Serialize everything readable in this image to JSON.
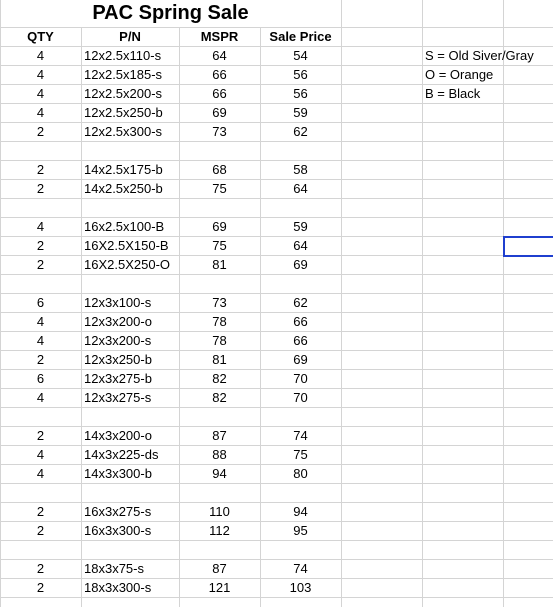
{
  "title": "PAC Spring Sale",
  "headers": {
    "qty": "QTY",
    "pn": "P/N",
    "mspr": "MSPR",
    "sale": "Sale Price"
  },
  "rows": [
    {
      "qty": "4",
      "pn": "12x2.5x110-s",
      "mspr": "64",
      "sale": "54"
    },
    {
      "qty": "4",
      "pn": "12x2.5x185-s",
      "mspr": "66",
      "sale": "56"
    },
    {
      "qty": "4",
      "pn": "12x2.5x200-s",
      "mspr": "66",
      "sale": "56"
    },
    {
      "qty": "4",
      "pn": "12x2.5x250-b",
      "mspr": "69",
      "sale": "59"
    },
    {
      "qty": "2",
      "pn": "12x2.5x300-s",
      "mspr": "73",
      "sale": "62"
    },
    null,
    {
      "qty": "2",
      "pn": "14x2.5x175-b",
      "mspr": "68",
      "sale": "58"
    },
    {
      "qty": "2",
      "pn": "14x2.5x250-b",
      "mspr": "75",
      "sale": "64"
    },
    null,
    {
      "qty": "4",
      "pn": "16x2.5x100-B",
      "mspr": "69",
      "sale": "59"
    },
    {
      "qty": "2",
      "pn": "16X2.5X150-B",
      "mspr": "75",
      "sale": "64"
    },
    {
      "qty": "2",
      "pn": "16X2.5X250-O",
      "mspr": "81",
      "sale": "69"
    },
    null,
    {
      "qty": "6",
      "pn": "12x3x100-s",
      "mspr": "73",
      "sale": "62"
    },
    {
      "qty": "4",
      "pn": "12x3x200-o",
      "mspr": "78",
      "sale": "66"
    },
    {
      "qty": "4",
      "pn": "12x3x200-s",
      "mspr": "78",
      "sale": "66"
    },
    {
      "qty": "2",
      "pn": "12x3x250-b",
      "mspr": "81",
      "sale": "69"
    },
    {
      "qty": "6",
      "pn": "12x3x275-b",
      "mspr": "82",
      "sale": "70"
    },
    {
      "qty": "4",
      "pn": "12x3x275-s",
      "mspr": "82",
      "sale": "70"
    },
    null,
    {
      "qty": "2",
      "pn": "14x3x200-o",
      "mspr": "87",
      "sale": "74"
    },
    {
      "qty": "4",
      "pn": "14x3x225-ds",
      "mspr": "88",
      "sale": "75"
    },
    {
      "qty": "4",
      "pn": "14x3x300-b",
      "mspr": "94",
      "sale": "80"
    },
    null,
    {
      "qty": "2",
      "pn": "16x3x275-s",
      "mspr": "110",
      "sale": "94"
    },
    {
      "qty": "2",
      "pn": "16x3x300-s",
      "mspr": "112",
      "sale": "95"
    },
    null,
    {
      "qty": "2",
      "pn": "18x3x75-s",
      "mspr": "87",
      "sale": "74"
    },
    {
      "qty": "2",
      "pn": "18x3x300-s",
      "mspr": "121",
      "sale": "103"
    }
  ],
  "legend": [
    "S = Old Siver/Gray",
    "O = Orange",
    "B = Black"
  ],
  "colors": {
    "gridline": "#d4d4d4",
    "selection": "#1f3fcf"
  }
}
